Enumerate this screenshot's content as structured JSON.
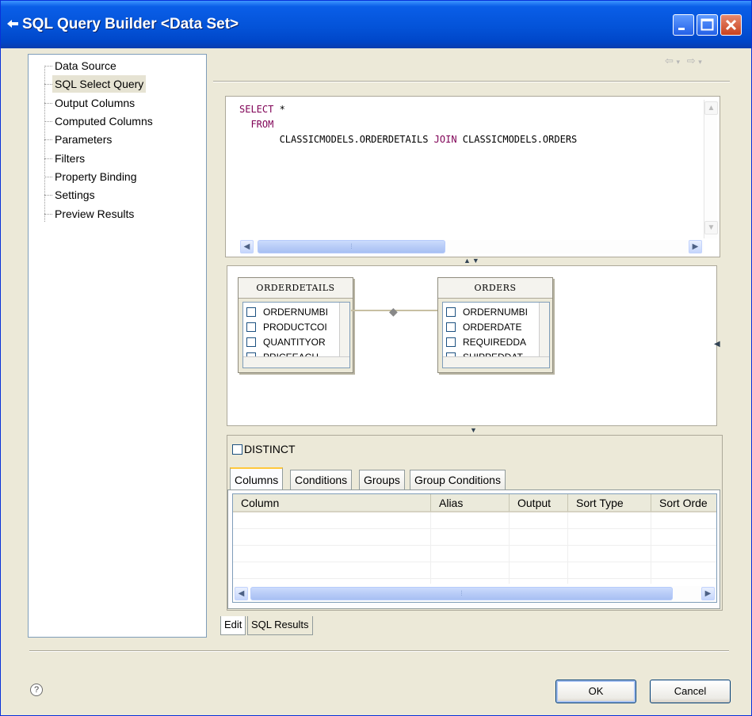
{
  "window": {
    "title": "SQL Query Builder <Data Set>",
    "title_color": "#0453d8",
    "icons": [
      "window-menu-icon",
      "minimize-icon",
      "maximize-icon",
      "close-icon"
    ]
  },
  "nav": {
    "items": [
      {
        "label": "Data Source"
      },
      {
        "label": "SQL Select Query",
        "selected": true
      },
      {
        "label": "Output Columns"
      },
      {
        "label": "Computed Columns"
      },
      {
        "label": "Parameters"
      },
      {
        "label": "Filters"
      },
      {
        "label": "Property Binding"
      },
      {
        "label": "Settings"
      },
      {
        "label": "Preview Results"
      }
    ]
  },
  "toolbar": {
    "back_icon": "back-arrow-icon",
    "forward_icon": "forward-arrow-icon",
    "back": "⇦",
    "forward": "⇨",
    "dropdown": "▾"
  },
  "sql": {
    "line1_kw": "SELECT",
    "line1_rest": " *",
    "line2_kw": "  FROM",
    "line3_pre": "       CLASSICMODELS.ORDERDETAILS ",
    "line3_kw": "JOIN",
    "line3_post": " CLASSICMODELS.ORDERS",
    "keyword_color": "#7f0055"
  },
  "diagram": {
    "tables": [
      {
        "name": "ORDERDETAILS",
        "columns": [
          "ORDERNUMBI",
          "PRODUCTCOI",
          "QUANTITYOR",
          "PRICEEACH"
        ]
      },
      {
        "name": "ORDERS",
        "columns": [
          "ORDERNUMBI",
          "ORDERDATE",
          "REQUIREDDA",
          "SHIPPEDDAT"
        ]
      }
    ]
  },
  "query_options": {
    "distinct_label": "DISTINCT",
    "distinct_checked": false
  },
  "tabs": {
    "items": [
      "Columns",
      "Conditions",
      "Groups",
      "Group Conditions"
    ],
    "active": "Columns"
  },
  "grid": {
    "headers": [
      "Column",
      "Alias",
      "Output",
      "Sort Type",
      "Sort Orde"
    ],
    "rows": 4
  },
  "bottom_tabs": {
    "items": [
      "Edit",
      "SQL Results"
    ],
    "active": "Edit"
  },
  "footer": {
    "help_icon": "help-icon",
    "help_glyph": "?",
    "ok_label": "OK",
    "cancel_label": "Cancel"
  },
  "scroll_glyphs": {
    "up": "▲",
    "down": "▼",
    "left": "◀",
    "right": "▶",
    "thumb": "⁞"
  }
}
